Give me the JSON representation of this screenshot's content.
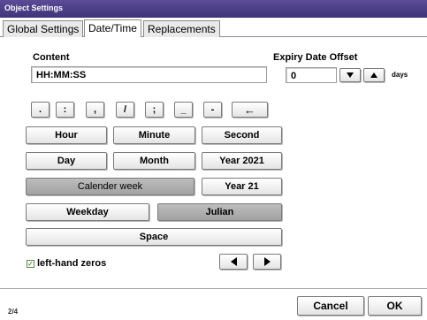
{
  "window": {
    "title": "Object Settings"
  },
  "tabs": [
    {
      "label": "Global Settings",
      "active": false
    },
    {
      "label": "Date/Time",
      "active": true
    },
    {
      "label": "Replacements",
      "active": false
    }
  ],
  "content": {
    "label": "Content",
    "value": "HH:MM:SS"
  },
  "expiry": {
    "label": "Expiry Date Offset",
    "value": "0",
    "unit": "days"
  },
  "symbols": [
    ".",
    ":",
    ",",
    "/",
    ";",
    "_",
    "-",
    "←"
  ],
  "buttons": {
    "hour": "Hour",
    "minute": "Minute",
    "second": "Second",
    "day": "Day",
    "month": "Month",
    "year4": "Year 2021",
    "calendar_week": "Calender week",
    "year2": "Year 21",
    "weekday": "Weekday",
    "julian": "Julian",
    "space": "Space"
  },
  "left_zeros": {
    "label": "left-hand zeros",
    "checked": true
  },
  "footer": {
    "page": "2/4",
    "cancel": "Cancel",
    "ok": "OK"
  },
  "colors": {
    "titlebar": "#4a3f88",
    "selected_button": "#aaaaaa"
  }
}
